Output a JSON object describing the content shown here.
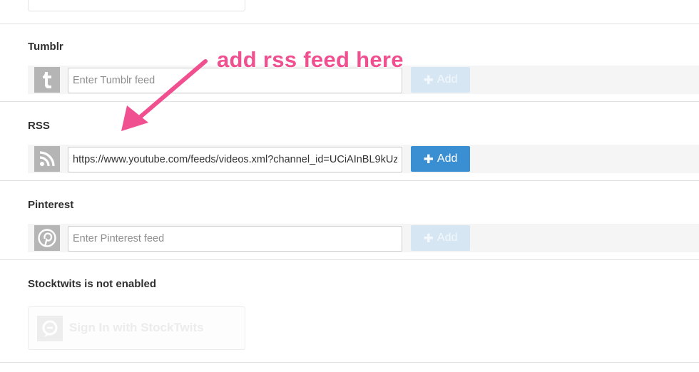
{
  "annotation": {
    "text": "add rss feed here",
    "color": "#f0508f"
  },
  "feeds": [
    {
      "label": "Tumblr",
      "icon": "tumblr-icon",
      "value": "",
      "placeholder": "Enter Tumblr feed",
      "button": "Add",
      "button_state": "disabled"
    },
    {
      "label": "RSS",
      "icon": "rss-icon",
      "value": "https://www.youtube.com/feeds/videos.xml?channel_id=UCiAInBL9kUz",
      "placeholder": "",
      "button": "Add",
      "button_state": "enabled"
    },
    {
      "label": "Pinterest",
      "icon": "pinterest-icon",
      "value": "",
      "placeholder": "Enter Pinterest feed",
      "button": "Add",
      "button_state": "disabled"
    }
  ],
  "stocktwits": {
    "label": "Stocktwits is not enabled",
    "button": "Sign In with StockTwits",
    "icon": "stocktwits-icon"
  },
  "colors": {
    "accent": "#3a8fd3",
    "disabled_button": "#d6e6f3",
    "icon_bg": "#b5b5b5"
  }
}
